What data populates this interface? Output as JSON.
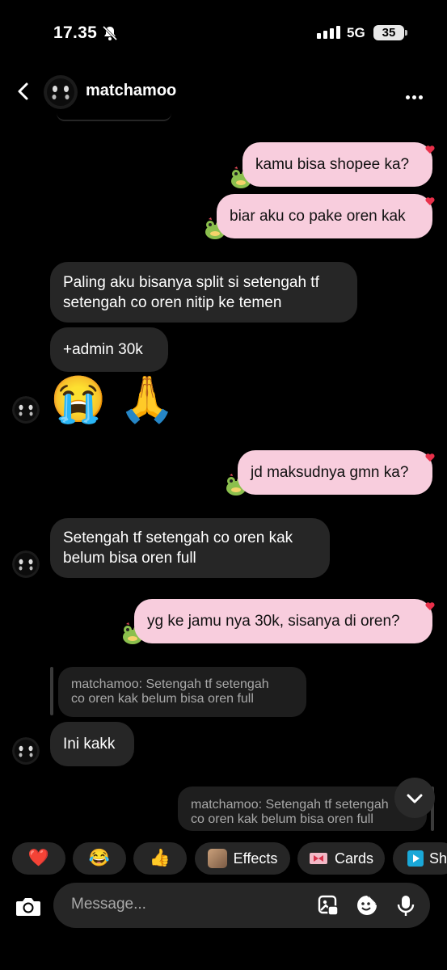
{
  "status_bar": {
    "time": "17.35",
    "network": "5G",
    "battery": "35"
  },
  "header": {
    "username": "matchamoo"
  },
  "messages": [
    {
      "side": "out",
      "text": "kamu bisa shopee ka?"
    },
    {
      "side": "out",
      "text": "biar aku co pake oren kak"
    },
    {
      "side": "in",
      "lines": [
        "Paling aku bisanya split si setengah tf",
        "setengah co oren nitip ke temen"
      ]
    },
    {
      "side": "in",
      "text": "+admin 30k"
    },
    {
      "side": "in",
      "emoji": "😭 🙏"
    },
    {
      "side": "out",
      "text": "jd maksudnya gmn ka?"
    },
    {
      "side": "in",
      "lines": [
        "Setengah tf setengah co oren kak",
        "belum bisa oren full"
      ]
    },
    {
      "side": "out",
      "text": "yg ke jamu nya 30k, sisanya di oren?"
    },
    {
      "side": "in",
      "reply_to": [
        "matchamoo: Setengah tf setengah",
        "co oren kak belum bisa oren full"
      ],
      "text": "Ini kakk"
    },
    {
      "side": "out",
      "reply_to": [
        "matchamoo: Setengah tf setengah",
        "co oren kak belum bisa oren full"
      ]
    }
  ],
  "quick_actions": {
    "heart": "❤️",
    "laugh": "😂",
    "thumbs": "👍",
    "effects": "Effects",
    "cards": "Cards",
    "shop": "Sh"
  },
  "composer": {
    "placeholder": "Message..."
  },
  "colors": {
    "outgoing_bubble": "#f8cddd",
    "incoming_bubble": "#262626",
    "background": "#000000"
  }
}
